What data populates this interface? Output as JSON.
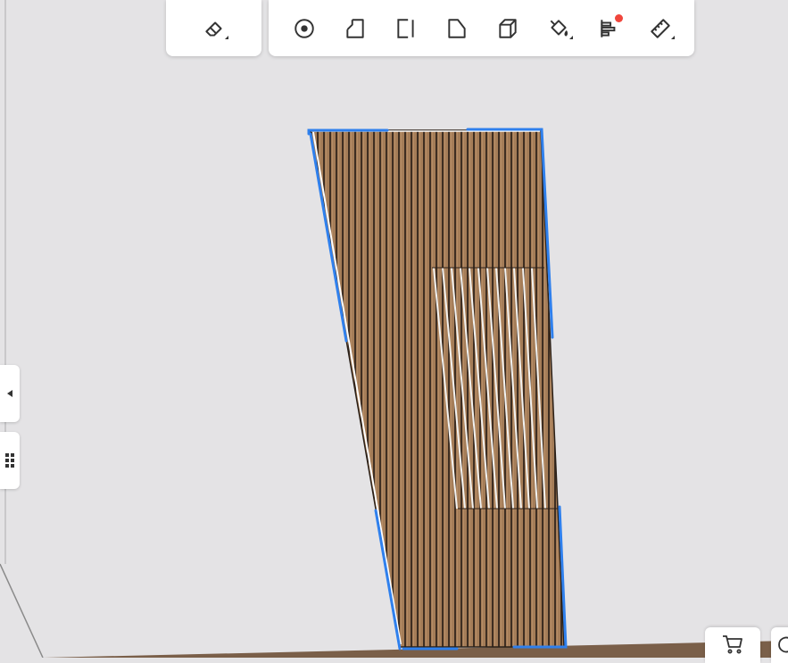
{
  "app": {
    "view": "3d-viewport"
  },
  "colors": {
    "background": "#e4e3e5",
    "floor": "#7a5f49",
    "slat_light": "#a57d58",
    "slat_dark": "#3e2e22",
    "selection": "#2f80ed",
    "notification": "#f0463c"
  },
  "toolbar_left": {
    "tools": [
      {
        "name": "eraser-icon",
        "has_submenu": true
      }
    ]
  },
  "toolbar_main": {
    "tools": [
      {
        "name": "circle-point-icon",
        "has_submenu": false
      },
      {
        "name": "corner-shape-icon",
        "has_submenu": false
      },
      {
        "name": "panel-shape-icon",
        "has_submenu": false
      },
      {
        "name": "angled-shape-icon",
        "has_submenu": false
      },
      {
        "name": "box-3d-icon",
        "has_submenu": false
      },
      {
        "name": "paint-bucket-icon",
        "has_submenu": true
      },
      {
        "name": "align-icon",
        "has_submenu": false,
        "notification": true
      },
      {
        "name": "ruler-icon",
        "has_submenu": true
      }
    ]
  },
  "side_panel": {
    "collapse_icon": "triangle-left-icon",
    "grid_icon": "grid-dots-icon"
  },
  "bottom_right": {
    "cart_icon": "cart-icon",
    "more_icon": "partial-icon"
  },
  "model": {
    "object": "slatted-wood-panel",
    "selected": true
  }
}
